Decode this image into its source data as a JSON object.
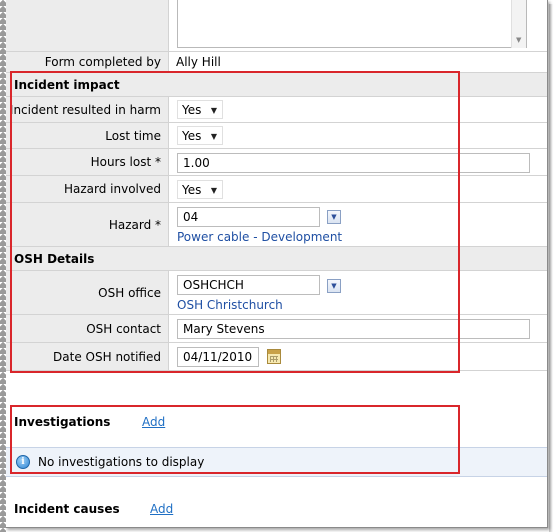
{
  "form": {
    "completed_by_label": "Form completed by",
    "completed_by_value": "Ally Hill"
  },
  "incident_impact": {
    "title": "Incident impact",
    "harm_label": "Incident resulted in harm",
    "harm_value": "Yes",
    "lost_time_label": "Lost time",
    "lost_time_value": "Yes",
    "hours_lost_label": "Hours lost *",
    "hours_lost_value": "1.00",
    "hazard_involved_label": "Hazard involved",
    "hazard_involved_value": "Yes",
    "hazard_label": "Hazard *",
    "hazard_code": "04",
    "hazard_description": "Power cable - Development"
  },
  "osh_details": {
    "title": "OSH Details",
    "office_label": "OSH office",
    "office_code": "OSHCHCH",
    "office_description": "OSH Christchurch",
    "contact_label": "OSH contact",
    "contact_value": "Mary Stevens",
    "date_label": "Date OSH notified",
    "date_value": "04/11/2010"
  },
  "investigations": {
    "title": "Investigations",
    "add_label": "Add",
    "empty_message": "No investigations to display"
  },
  "incident_causes": {
    "title": "Incident causes",
    "add_label": "Add"
  },
  "icons": {
    "dropdown": "chevron-down-icon",
    "lookup": "lookup-dropdown-icon",
    "calendar": "calendar-icon",
    "info": "info-icon"
  },
  "colors": {
    "highlight": "#d9262b",
    "link": "#1f6fc4",
    "label_bg": "#ececec",
    "info_bg": "#eef3fa"
  }
}
